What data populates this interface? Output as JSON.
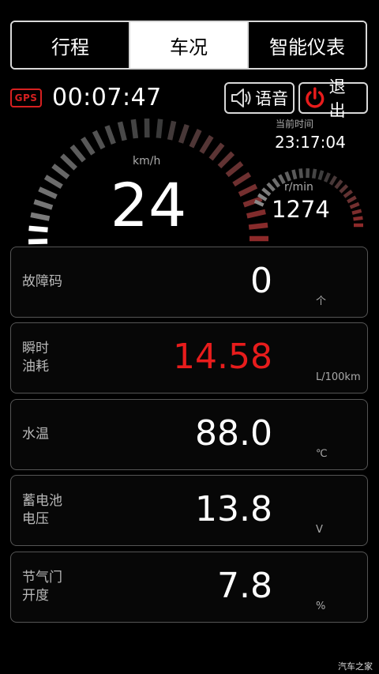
{
  "tabs": [
    "行程",
    "车况",
    "智能仪表"
  ],
  "active_tab": 1,
  "gps_badge": "GPS",
  "trip_timer": "00:07:47",
  "voice_button": "语音",
  "exit_button": "退出",
  "clock": {
    "label": "当前时间",
    "time": "23:17:04"
  },
  "speed": {
    "unit": "km/h",
    "value": "24"
  },
  "rpm": {
    "unit": "r/min",
    "value": "1274"
  },
  "metrics": [
    {
      "label": "故障码",
      "value": "0",
      "unit": "个"
    },
    {
      "label": "瞬时\n油耗",
      "value": "14.58",
      "unit": "L/100km",
      "alert": true
    },
    {
      "label": "水温",
      "value": "88.0",
      "unit": "℃"
    },
    {
      "label": "蓄电池\n电压",
      "value": "13.8",
      "unit": "V"
    },
    {
      "label": "节气门\n开度",
      "value": "7.8",
      "unit": "%"
    }
  ],
  "icons": {
    "voice": "speaker-icon",
    "exit": "power-icon"
  },
  "colors": {
    "accent_red": "#e81c1c",
    "gauge_light": "#8a8a8a",
    "gauge_dark": "#3a3a3a",
    "gauge_red": "#8e2a2a"
  },
  "watermark": "汽车之家"
}
